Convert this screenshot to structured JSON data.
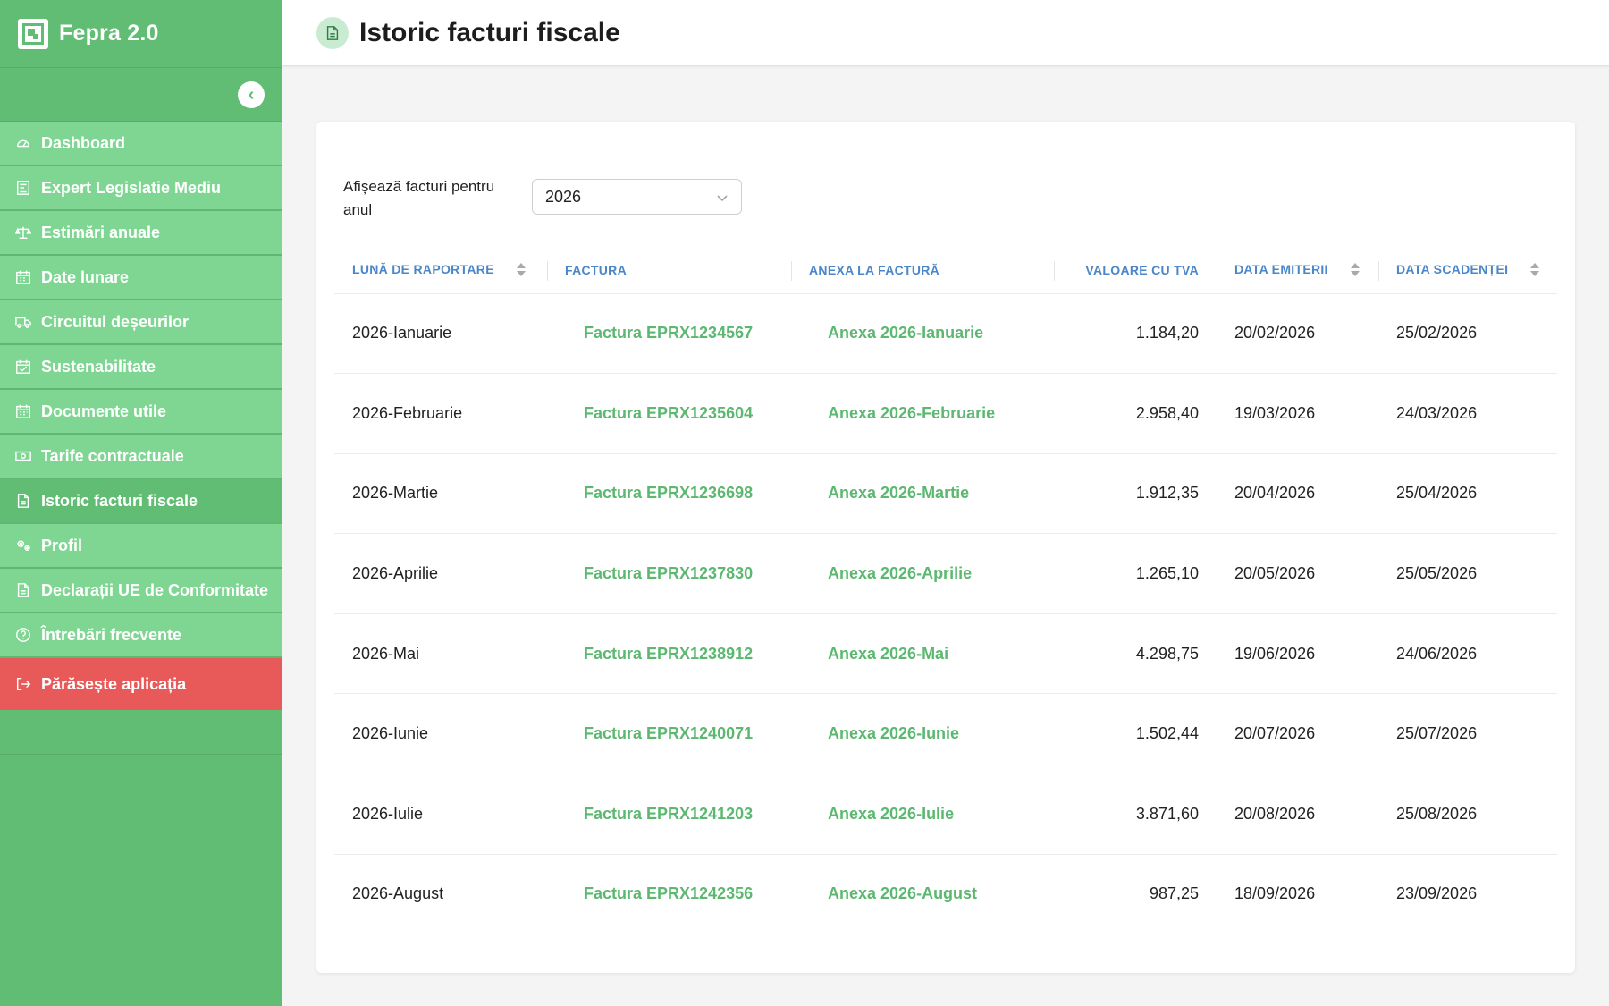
{
  "app": {
    "name": "Fepra 2.0"
  },
  "sidebar": {
    "collapse_icon": "chevron-left-icon",
    "items": [
      {
        "label": "Dashboard",
        "icon": "gauge-icon",
        "active": false
      },
      {
        "label": "Expert Legislatie Mediu",
        "icon": "document-icon",
        "active": false
      },
      {
        "label": "Estimări anuale",
        "icon": "scale-icon",
        "active": false
      },
      {
        "label": "Date lunare",
        "icon": "calendar-icon",
        "active": false
      },
      {
        "label": "Circuitul deșeurilor",
        "icon": "truck-icon",
        "active": false
      },
      {
        "label": "Sustenabilitate",
        "icon": "calendar-check-icon",
        "active": false
      },
      {
        "label": "Documente utile",
        "icon": "calendar-icon",
        "active": false
      },
      {
        "label": "Tarife contractuale",
        "icon": "money-icon",
        "active": false
      },
      {
        "label": "Istoric facturi fiscale",
        "icon": "file-icon",
        "active": true
      },
      {
        "label": "Profil",
        "icon": "gears-icon",
        "active": false
      },
      {
        "label": "Declarații UE de Conformitate",
        "icon": "file-icon",
        "active": false
      },
      {
        "label": "Întrebări frecvente",
        "icon": "question-icon",
        "active": false
      }
    ],
    "exit": {
      "label": "Părăsește aplicația",
      "icon": "logout-icon"
    }
  },
  "header": {
    "title": "Istoric facturi fiscale",
    "icon": "file-icon"
  },
  "filter": {
    "label": "Afișează facturi pentru anul",
    "selected_year": "2026"
  },
  "table": {
    "headers": {
      "month": "LUNĂ DE RAPORTARE",
      "invoice": "FACTURA",
      "annex": "ANEXA LA FACTURĂ",
      "value": "VALOARE CU TVA",
      "issue_date": "DATA EMITERII",
      "due_date": "DATA SCADENȚEI"
    },
    "rows": [
      {
        "month": "2026-Ianuarie",
        "invoice": "Factura EPRX1234567",
        "annex": "Anexa 2026-Ianuarie",
        "value": "1.184,20",
        "issue_date": "20/02/2026",
        "due_date": "25/02/2026"
      },
      {
        "month": "2026-Februarie",
        "invoice": "Factura EPRX1235604",
        "annex": "Anexa 2026-Februarie",
        "value": "2.958,40",
        "issue_date": "19/03/2026",
        "due_date": "24/03/2026"
      },
      {
        "month": "2026-Martie",
        "invoice": "Factura EPRX1236698",
        "annex": "Anexa 2026-Martie",
        "value": "1.912,35",
        "issue_date": "20/04/2026",
        "due_date": "25/04/2026"
      },
      {
        "month": "2026-Aprilie",
        "invoice": "Factura EPRX1237830",
        "annex": "Anexa 2026-Aprilie",
        "value": "1.265,10",
        "issue_date": "20/05/2026",
        "due_date": "25/05/2026"
      },
      {
        "month": "2026-Mai",
        "invoice": "Factura EPRX1238912",
        "annex": "Anexa 2026-Mai",
        "value": "4.298,75",
        "issue_date": "19/06/2026",
        "due_date": "24/06/2026"
      },
      {
        "month": "2026-Iunie",
        "invoice": "Factura EPRX1240071",
        "annex": "Anexa 2026-Iunie",
        "value": "1.502,44",
        "issue_date": "20/07/2026",
        "due_date": "25/07/2026"
      },
      {
        "month": "2026-Iulie",
        "invoice": "Factura EPRX1241203",
        "annex": "Anexa 2026-Iulie",
        "value": "3.871,60",
        "issue_date": "20/08/2026",
        "due_date": "25/08/2026"
      },
      {
        "month": "2026-August",
        "invoice": "Factura EPRX1242356",
        "annex": "Anexa 2026-August",
        "value": "987,25",
        "issue_date": "18/09/2026",
        "due_date": "23/09/2026"
      }
    ]
  },
  "colors": {
    "sidebar": "#62bd74",
    "nav_item": "#7ed692",
    "exit": "#e85a5a",
    "link": "#5cb870",
    "header_text": "#4b86c8"
  }
}
